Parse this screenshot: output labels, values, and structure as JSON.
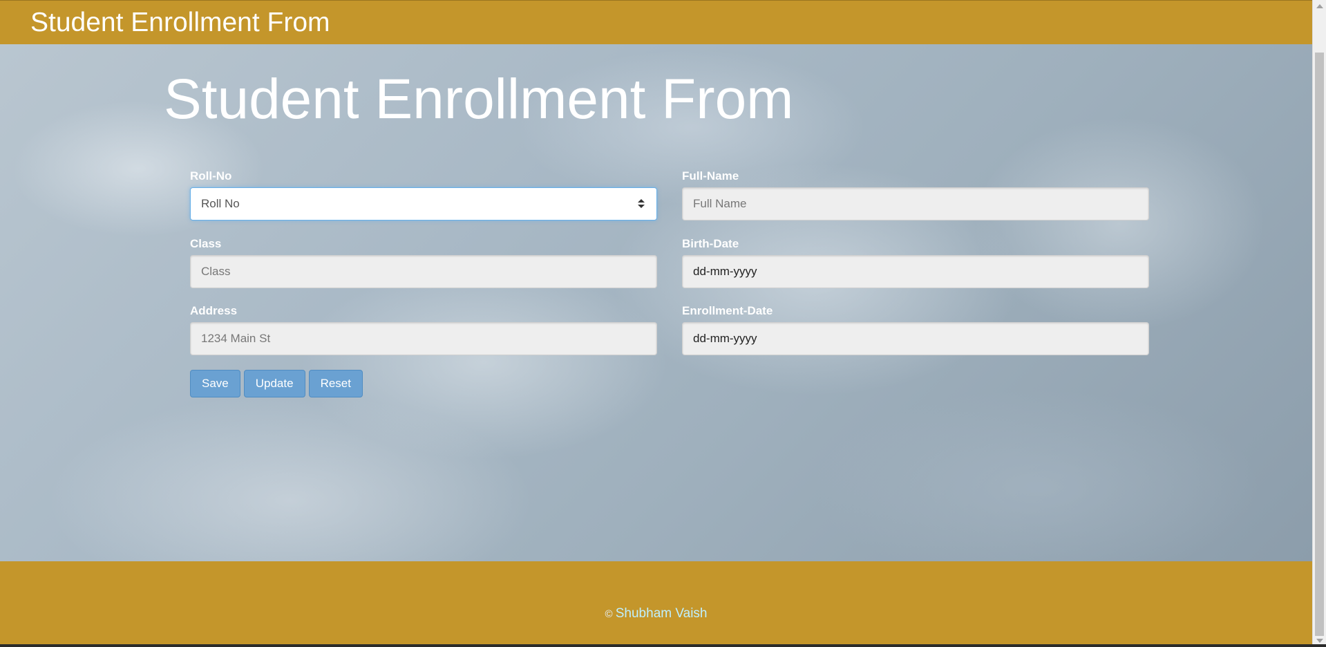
{
  "navbar": {
    "title": "Student Enrollment From"
  },
  "main": {
    "heading": "Student Enrollment From"
  },
  "form": {
    "roll_no": {
      "label": "Roll-No",
      "placeholder": "Roll No",
      "value": ""
    },
    "full_name": {
      "label": "Full-Name",
      "placeholder": "Full Name",
      "value": ""
    },
    "class": {
      "label": "Class",
      "placeholder": "Class",
      "value": ""
    },
    "birth_date": {
      "label": "Birth-Date",
      "display": "dd-mm-yyyy"
    },
    "address": {
      "label": "Address",
      "placeholder": "1234 Main St",
      "value": ""
    },
    "enrollment_date": {
      "label": "Enrollment-Date",
      "display": "dd-mm-yyyy"
    }
  },
  "buttons": {
    "save": "Save",
    "update": "Update",
    "reset": "Reset"
  },
  "footer": {
    "copyright": "©",
    "author": "Shubham Vaish"
  },
  "colors": {
    "brand_bar": "#c4962b",
    "button": "#6aa1d2",
    "focus_border": "#66afe9",
    "footer_link": "#bff0ff"
  },
  "icons": {
    "spinner": "number-spinner-icon",
    "scroll_up": "scroll-up-arrow-icon",
    "scroll_down": "scroll-down-arrow-icon"
  }
}
